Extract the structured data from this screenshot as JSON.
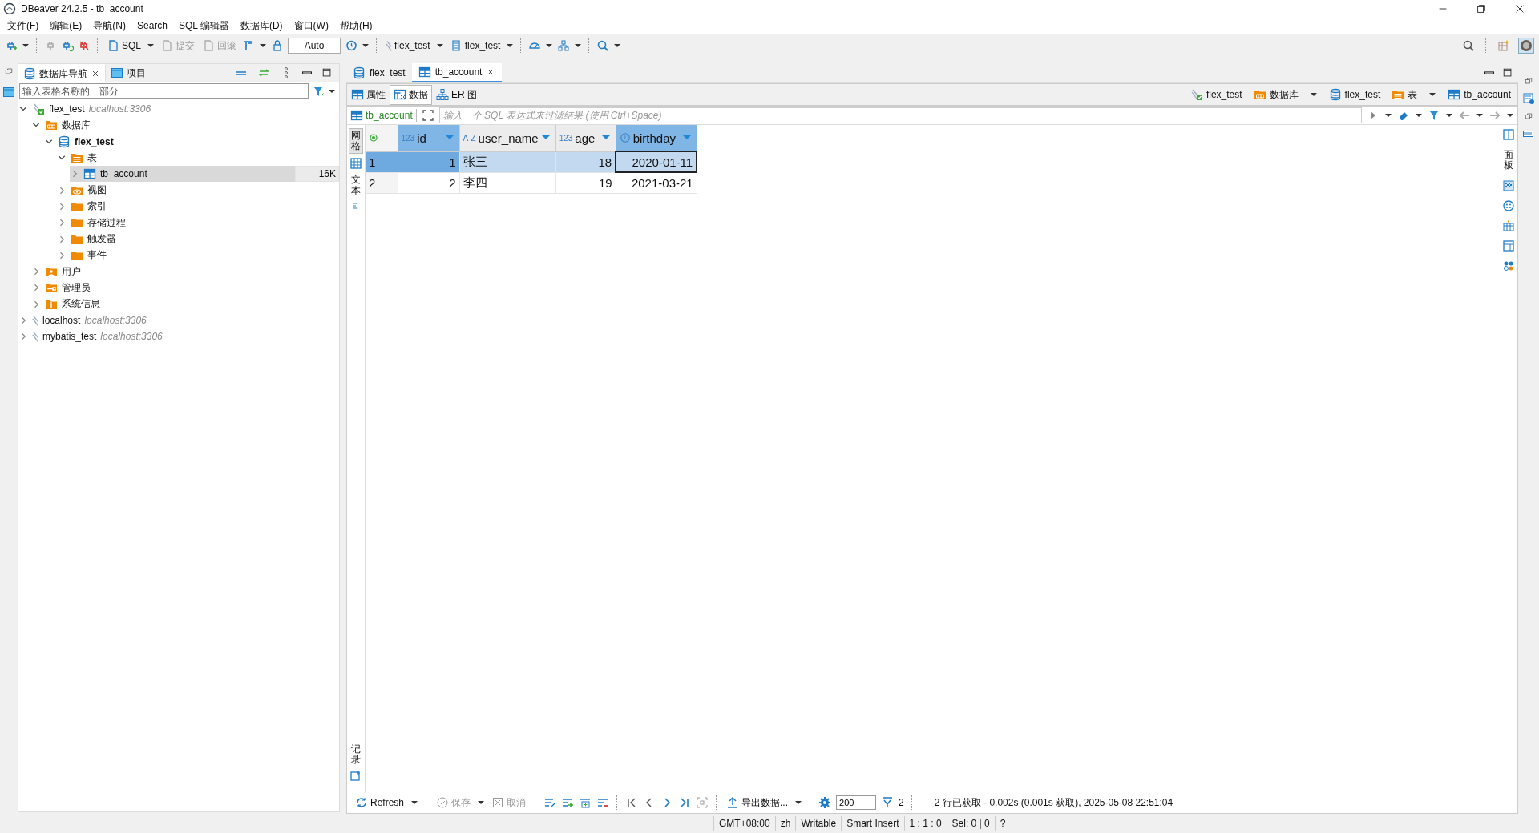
{
  "window": {
    "title": "DBeaver 24.2.5 - tb_account"
  },
  "menu": [
    "文件(F)",
    "编辑(E)",
    "导航(N)",
    "Search",
    "SQL 编辑器",
    "数据库(D)",
    "窗口(W)",
    "帮助(H)"
  ],
  "toolbar": {
    "sql": "SQL",
    "commit": {
      "label": "提交",
      "disabled": true
    },
    "rollback": {
      "label": "回滚",
      "disabled": true
    },
    "transaction_mode": "Auto",
    "connection": "flex_test",
    "database": "flex_test"
  },
  "navigator": {
    "tabs": [
      {
        "label": "数据库导航",
        "selected": true
      },
      {
        "label": "项目",
        "selected": false
      }
    ],
    "filter": {
      "placeholder": "输入表格名称的一部分"
    },
    "tree": [
      {
        "label": "flex_test",
        "detail": "localhost:3306",
        "kind": "connection",
        "connected": true,
        "expanded": true,
        "selected": false,
        "children": [
          {
            "label": "数据库",
            "kind": "databases",
            "expanded": true,
            "selected": false,
            "children": [
              {
                "label": "flex_test",
                "kind": "database",
                "bold": true,
                "expanded": true,
                "selected": false,
                "children": [
                  {
                    "label": "表",
                    "kind": "tables",
                    "expanded": true,
                    "selected": false,
                    "children": [
                      {
                        "label": "tb_account",
                        "kind": "table",
                        "size": "16K",
                        "expanded": false,
                        "selected": true
                      }
                    ]
                  },
                  {
                    "label": "视图",
                    "kind": "views",
                    "expanded": false,
                    "selected": false
                  },
                  {
                    "label": "索引",
                    "kind": "folder",
                    "expanded": false,
                    "selected": false
                  },
                  {
                    "label": "存储过程",
                    "kind": "folder",
                    "expanded": false,
                    "selected": false
                  },
                  {
                    "label": "触发器",
                    "kind": "folder",
                    "expanded": false,
                    "selected": false
                  },
                  {
                    "label": "事件",
                    "kind": "folder",
                    "expanded": false,
                    "selected": false
                  }
                ]
              }
            ]
          },
          {
            "label": "用户",
            "kind": "users",
            "expanded": false,
            "selected": false
          },
          {
            "label": "管理员",
            "kind": "admin",
            "expanded": false,
            "selected": false
          },
          {
            "label": "系统信息",
            "kind": "info",
            "expanded": false,
            "selected": false
          }
        ]
      },
      {
        "label": "localhost",
        "detail": "localhost:3306",
        "kind": "connection",
        "connected": false,
        "expanded": false,
        "selected": false
      },
      {
        "label": "mybatis_test",
        "detail": "localhost:3306",
        "kind": "connection",
        "connected": false,
        "expanded": false,
        "selected": false
      }
    ]
  },
  "editor": {
    "tabs": [
      {
        "label": "flex_test",
        "kind": "database",
        "selected": false
      },
      {
        "label": "tb_account",
        "kind": "table",
        "selected": true
      }
    ],
    "subtabs": [
      {
        "label": "属性",
        "kind": "table",
        "selected": false
      },
      {
        "label": "数据",
        "kind": "data",
        "selected": true
      },
      {
        "label": "ER 图",
        "kind": "er",
        "selected": false
      }
    ],
    "breadcrumb": [
      {
        "label": "flex_test",
        "kind": "connection"
      },
      {
        "label": "数据库",
        "kind": "databases"
      },
      {
        "label": "flex_test",
        "kind": "database"
      },
      {
        "label": "表",
        "kind": "tables"
      },
      {
        "label": "tb_account",
        "kind": "table"
      }
    ],
    "filter": {
      "table": "tb_account",
      "placeholder": "输入一个 SQL 表达式来过滤结果 (使用 Ctrl+Space)"
    },
    "side_tabs": [
      {
        "label": "网格",
        "selected": true
      },
      {
        "label": "文本",
        "selected": false
      }
    ],
    "record_tab": "记录",
    "panel_tab": "面板",
    "grid": {
      "columns": [
        {
          "name": "id",
          "kind": "number",
          "type_label": "123",
          "selected": true
        },
        {
          "name": "user_name",
          "kind": "string",
          "type_label": "A-Z",
          "selected": false
        },
        {
          "name": "age",
          "kind": "number",
          "type_label": "123",
          "selected": false
        },
        {
          "name": "birthday",
          "kind": "date",
          "selected": true
        }
      ],
      "rows": [
        {
          "number": "1",
          "selected": true,
          "cells": [
            {
              "value": "1",
              "focused": false
            },
            {
              "value": "张三",
              "focused": false
            },
            {
              "value": "18",
              "focused": false
            },
            {
              "value": "2020-01-11",
              "focused": true
            }
          ]
        },
        {
          "number": "2",
          "selected": false,
          "cells": [
            {
              "value": "2",
              "focused": false
            },
            {
              "value": "李四",
              "focused": false
            },
            {
              "value": "19",
              "focused": false
            },
            {
              "value": "2021-03-21",
              "focused": false
            }
          ]
        }
      ]
    },
    "bottom": {
      "refresh": "Refresh",
      "save": {
        "label": "保存",
        "disabled": true
      },
      "cancel": {
        "label": "取消",
        "disabled": true
      },
      "export": "导出数据...",
      "fetch_size": "200",
      "row_count": "2",
      "message": "2 行已获取 - 0.002s (0.001s 获取), 2025-05-08 22:51:04"
    }
  },
  "status_bar": [
    "GMT+08:00",
    "zh",
    "Writable",
    "Smart Insert",
    "1 : 1 : 0",
    "Sel: 0 | 0",
    "?"
  ]
}
